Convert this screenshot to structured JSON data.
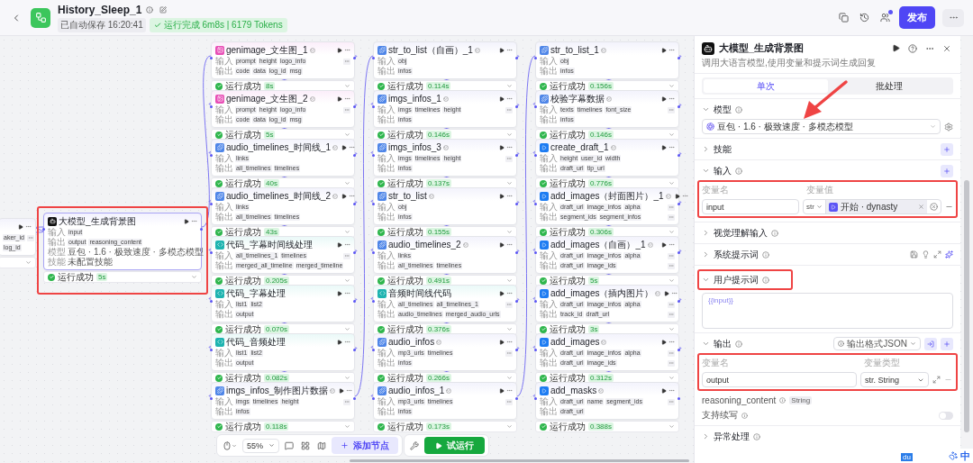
{
  "topbar": {
    "title": "History_Sleep_1",
    "autosave": "已自动保存 16:20:41",
    "run_status": "运行完成 6m8s | 6179 Tokens",
    "publish": "发布"
  },
  "canvas": {
    "partial_node": {
      "rows": [
        {
          "chips": [
            "aker_id"
          ],
          "more": true
        },
        {
          "chips": [
            "log_id"
          ],
          "more": false
        }
      ]
    },
    "llm_node": {
      "title": "大模型_生成背景图",
      "kind": "llm",
      "selected": true,
      "badge": false,
      "rows": [
        {
          "label": "输入",
          "chips": [
            "input"
          ],
          "more": false
        },
        {
          "label": "输出",
          "chips": [
            "output",
            "reasoning_content"
          ],
          "more": false
        },
        {
          "label": "模型",
          "model": "豆包 · 1.6 · 极致速度 · 多模态模型"
        },
        {
          "label": "技能",
          "text": "未配置技能"
        }
      ],
      "status": "运行成功",
      "time": "5s"
    },
    "columns": [
      [
        {
          "title": "genimage_文生图_1",
          "kind": "image",
          "badge": true,
          "rows": [
            {
              "label": "输入",
              "chips": [
                "prompt",
                "height",
                "logo_info"
              ],
              "more": true
            },
            {
              "label": "输出",
              "chips": [
                "code",
                "data",
                "log_id",
                "msg"
              ],
              "more": false
            }
          ],
          "status": "运行成功",
          "time": "8s"
        },
        {
          "title": "genimage_文生图_2",
          "kind": "image",
          "badge": true,
          "rows": [
            {
              "label": "输入",
              "chips": [
                "prompt",
                "height",
                "logo_info"
              ],
              "more": true
            },
            {
              "label": "输出",
              "chips": [
                "code",
                "data",
                "log_id",
                "msg"
              ],
              "more": false
            }
          ],
          "status": "运行成功",
          "time": "5s"
        },
        {
          "title": "audio_timelines_时间线_1",
          "kind": "plugin",
          "badge": true,
          "rows": [
            {
              "label": "输入",
              "chips": [
                "links"
              ],
              "more": false
            },
            {
              "label": "输出",
              "chips": [
                "all_timelines",
                "timelines"
              ],
              "more": false
            }
          ],
          "status": "运行成功",
          "time": "40s"
        },
        {
          "title": "audio_timelines_时间线_2",
          "kind": "plugin",
          "badge": true,
          "rows": [
            {
              "label": "输入",
              "chips": [
                "links"
              ],
              "more": false
            },
            {
              "label": "输出",
              "chips": [
                "all_timelines",
                "timelines"
              ],
              "more": false
            }
          ],
          "status": "运行成功",
          "time": "43s"
        },
        {
          "title": "代码_字幕时间线处理",
          "kind": "code",
          "badge": false,
          "rows": [
            {
              "label": "输入",
              "chips": [
                "all_timelines_1",
                "timelines"
              ],
              "more": true
            },
            {
              "label": "输出",
              "chips": [
                "merged_all_timeline",
                "merged_timeline"
              ],
              "more": false
            }
          ],
          "status": "运行成功",
          "time": "0.205s"
        },
        {
          "title": "代码_字幕处理",
          "kind": "code",
          "badge": false,
          "rows": [
            {
              "label": "输入",
              "chips": [
                "list1",
                "list2"
              ],
              "more": false
            },
            {
              "label": "输出",
              "chips": [
                "output"
              ],
              "more": false
            }
          ],
          "status": "运行成功",
          "time": "0.070s"
        },
        {
          "title": "代码_音频处理",
          "kind": "code",
          "badge": false,
          "rows": [
            {
              "label": "输入",
              "chips": [
                "list1",
                "list2"
              ],
              "more": false
            },
            {
              "label": "输出",
              "chips": [
                "output"
              ],
              "more": false
            }
          ],
          "status": "运行成功",
          "time": "0.082s"
        },
        {
          "title": "imgs_infos_制作图片数据",
          "kind": "plugin",
          "badge": true,
          "rows": [
            {
              "label": "输入",
              "chips": [
                "imgs",
                "timelines",
                "height"
              ],
              "more": true
            },
            {
              "label": "输出",
              "chips": [
                "infos"
              ],
              "more": false
            }
          ],
          "status": "运行成功",
          "time": "0.118s"
        }
      ],
      [
        {
          "title": "str_to_list（自画）_1",
          "kind": "plugin",
          "badge": true,
          "rows": [
            {
              "label": "输入",
              "chips": [
                "obj"
              ],
              "more": false
            },
            {
              "label": "输出",
              "chips": [
                "infos"
              ],
              "more": false
            }
          ],
          "status": "运行成功",
          "time": "0.114s"
        },
        {
          "title": "imgs_infos_1",
          "kind": "plugin",
          "badge": true,
          "rows": [
            {
              "label": "输入",
              "chips": [
                "imgs",
                "timelines",
                "height"
              ],
              "more": true
            },
            {
              "label": "输出",
              "chips": [
                "infos"
              ],
              "more": false
            }
          ],
          "status": "运行成功",
          "time": "0.146s"
        },
        {
          "title": "imgs_infos_3",
          "kind": "plugin",
          "badge": true,
          "rows": [
            {
              "label": "输入",
              "chips": [
                "imgs",
                "timelines",
                "height"
              ],
              "more": true
            },
            {
              "label": "输出",
              "chips": [
                "infos"
              ],
              "more": false
            }
          ],
          "status": "运行成功",
          "time": "0.137s"
        },
        {
          "title": "str_to_list",
          "kind": "plugin",
          "badge": true,
          "rows": [
            {
              "label": "输入",
              "chips": [
                "obj"
              ],
              "more": false
            },
            {
              "label": "输出",
              "chips": [
                "infos"
              ],
              "more": false
            }
          ],
          "status": "运行成功",
          "time": "0.155s"
        },
        {
          "title": "audio_timelines_2",
          "kind": "plugin",
          "badge": true,
          "rows": [
            {
              "label": "输入",
              "chips": [
                "links"
              ],
              "more": false
            },
            {
              "label": "输出",
              "chips": [
                "all_timelines",
                "timelines"
              ],
              "more": false
            }
          ],
          "status": "运行成功",
          "time": "0.491s"
        },
        {
          "title": "音频时间线代码",
          "kind": "code",
          "badge": false,
          "rows": [
            {
              "label": "输入",
              "chips": [
                "all_timelines",
                "all_timelines_1"
              ],
              "more": true
            },
            {
              "label": "输出",
              "chips": [
                "audio_timelines",
                "merged_audio_urls"
              ],
              "more": false
            }
          ],
          "status": "运行成功",
          "time": "0.376s"
        },
        {
          "title": "audio_infos",
          "kind": "plugin",
          "badge": true,
          "rows": [
            {
              "label": "输入",
              "chips": [
                "mp3_urls",
                "timelines"
              ],
              "more": true
            },
            {
              "label": "输出",
              "chips": [
                "infos"
              ],
              "more": false
            }
          ],
          "status": "运行成功",
          "time": "0.266s"
        },
        {
          "title": "audio_infos_1",
          "kind": "plugin",
          "badge": true,
          "rows": [
            {
              "label": "输入",
              "chips": [
                "mp3_urls",
                "timelines"
              ],
              "more": true
            },
            {
              "label": "输出",
              "chips": [
                "infos"
              ],
              "more": false
            }
          ],
          "status": "运行成功",
          "time": "0.173s"
        }
      ],
      [
        {
          "title": "str_to_list_1",
          "kind": "plugin",
          "badge": true,
          "rows": [
            {
              "label": "输入",
              "chips": [
                "obj"
              ],
              "more": false
            },
            {
              "label": "输出",
              "chips": [
                "infos"
              ],
              "more": false
            }
          ],
          "status": "运行成功",
          "time": "0.156s"
        },
        {
          "title": "校验字幕数据",
          "kind": "plugin",
          "badge": true,
          "rows": [
            {
              "label": "输入",
              "chips": [
                "texts",
                "timelines",
                "font_size"
              ],
              "more": true
            },
            {
              "label": "输出",
              "chips": [
                "infos"
              ],
              "more": false
            }
          ],
          "status": "运行成功",
          "time": "0.146s"
        },
        {
          "title": "create_draft_1",
          "kind": "draft",
          "badge": true,
          "rows": [
            {
              "label": "输入",
              "chips": [
                "height",
                "user_id",
                "width"
              ],
              "more": false
            },
            {
              "label": "输出",
              "chips": [
                "draft_url",
                "tip_url"
              ],
              "more": false
            }
          ],
          "status": "运行成功",
          "time": "0.776s"
        },
        {
          "title": "add_images（封面图片）_1",
          "kind": "draft",
          "badge": true,
          "rows": [
            {
              "label": "输入",
              "chips": [
                "draft_url",
                "image_infos",
                "alpha"
              ],
              "more": true
            },
            {
              "label": "输出",
              "chips": [
                "segment_ids",
                "segment_infos"
              ],
              "more": true
            }
          ],
          "status": "运行成功",
          "time": "0.306s"
        },
        {
          "title": "add_images（自画）_1",
          "kind": "draft",
          "badge": true,
          "rows": [
            {
              "label": "输入",
              "chips": [
                "draft_url",
                "image_infos",
                "alpha"
              ],
              "more": true
            },
            {
              "label": "输出",
              "chips": [
                "draft_url",
                "image_ids"
              ],
              "more": true
            }
          ],
          "status": "运行成功",
          "time": "5s"
        },
        {
          "title": "add_images（插内图片）",
          "kind": "draft",
          "badge": true,
          "rows": [
            {
              "label": "输入",
              "chips": [
                "draft_url",
                "image_infos",
                "alpha"
              ],
              "more": true
            },
            {
              "label": "输出",
              "chips": [
                "track_id",
                "draft_url"
              ],
              "more": true
            }
          ],
          "status": "运行成功",
          "time": "3s"
        },
        {
          "title": "add_images",
          "kind": "draft",
          "badge": true,
          "rows": [
            {
              "label": "输入",
              "chips": [
                "draft_url",
                "image_infos",
                "alpha"
              ],
              "more": true
            },
            {
              "label": "输出",
              "chips": [
                "draft_url",
                "image_ids"
              ],
              "more": true
            }
          ],
          "status": "运行成功",
          "time": "0.312s"
        },
        {
          "title": "add_masks",
          "kind": "draft",
          "badge": true,
          "rows": [
            {
              "label": "输入",
              "chips": [
                "draft_url",
                "name",
                "segment_ids"
              ],
              "more": true
            },
            {
              "label": "输出",
              "chips": [
                "draft_url"
              ],
              "more": false
            }
          ],
          "status": "运行成功",
          "time": "0.388s"
        }
      ]
    ]
  },
  "toolbar": {
    "zoom": "55%",
    "add_node": "添加节点",
    "test_run": "试运行"
  },
  "panel": {
    "title": "大模型_生成背景图",
    "description": "调用大语言模型,使用变量和提示词生成回复",
    "tabs": [
      {
        "label": "单次",
        "selected": true
      },
      {
        "label": "批处理",
        "selected": false
      }
    ],
    "sections": [
      {
        "kind": "model",
        "label": "模型",
        "expanded": true,
        "info": true,
        "model": "豆包 · 1.6 · 极致速度 · 多模态模型"
      },
      {
        "kind": "plain",
        "label": "技能",
        "expanded": false,
        "info": false,
        "add": true
      },
      {
        "kind": "inputs",
        "label": "输入",
        "expanded": true,
        "info": true,
        "add": true,
        "name_header": "变量名",
        "value_header": "变量值",
        "rows": [
          {
            "name": "input",
            "type": "str",
            "ref": "开始 · dynasty"
          }
        ]
      },
      {
        "kind": "plain",
        "label": "视觉理解输入",
        "expanded": false,
        "info": true,
        "add": false
      },
      {
        "kind": "system",
        "label": "系统提示词",
        "expanded": false,
        "info": true,
        "add": false
      },
      {
        "kind": "prompt",
        "label": "用户提示词",
        "expanded": true,
        "info": true,
        "add": false,
        "value": "{{input}}"
      },
      {
        "kind": "outputs",
        "label": "输出",
        "expanded": true,
        "info": true,
        "add": true,
        "format": "输出格式JSON",
        "name_header": "变量名",
        "type_header": "变量类型",
        "rows": [
          {
            "name": "output",
            "type": "str. String"
          }
        ],
        "extra": {
          "name": "reasoning_content",
          "type": "String"
        },
        "continue": {
          "label": "支持续写",
          "on": false
        }
      },
      {
        "kind": "plain",
        "label": "异常处理",
        "expanded": false,
        "info": true,
        "add": false
      }
    ]
  },
  "ime": {
    "logo": "du",
    "label": "中"
  }
}
